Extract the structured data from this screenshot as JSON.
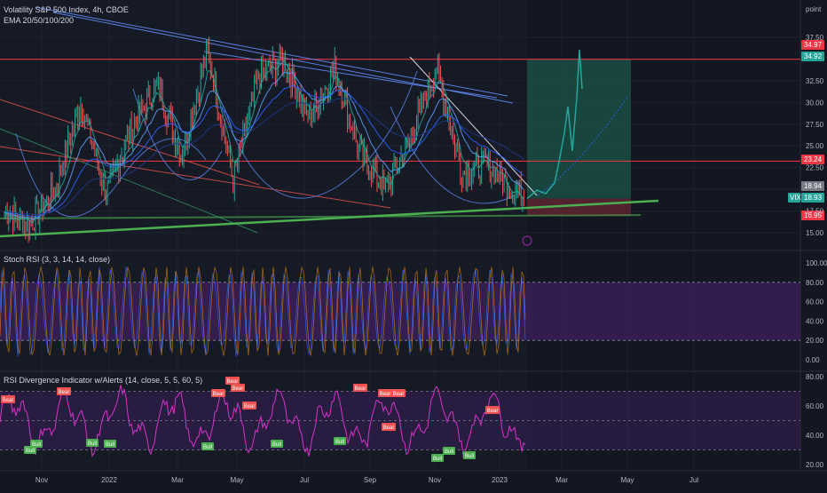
{
  "header": {
    "symbol_title": "Volatility S&P 500 Index, 4h, CBOE",
    "ema_label": "EMA 20/50/100/200",
    "stoch_label": "Stoch RSI (3, 3, 14, 14, close)",
    "rsidiv_label": "RSI Divergence Indicator w/Alerts (14, close, 5, 5, 60, 5)",
    "price_axis_title": "point"
  },
  "colors": {
    "background": "#131722",
    "price_up": "#26a69a",
    "price_down": "#ef5350",
    "resistance": "#f23645",
    "support": "#4caf50",
    "downtrend": "#5b7fe0",
    "target_box": "#1b4d44",
    "stop_box": "#5a2331",
    "stoch_band": "#3b1f5a",
    "rsi_line": "#d633c8",
    "bear_label": "#ef5350",
    "bull_label": "#4caf50"
  },
  "price_axis": {
    "ticks": [
      "37.50",
      "32.50",
      "30.00",
      "27.50",
      "25.00",
      "22.50",
      "17.50",
      "15.00"
    ]
  },
  "price_tags": [
    {
      "text": "34.97",
      "color": "#f23645"
    },
    {
      "text": "34.92",
      "color": "#26a69a"
    },
    {
      "text": "23.24",
      "color": "#f23645"
    },
    {
      "text": "18.94",
      "color": "#787b86"
    },
    {
      "text": "18.93",
      "color": "#26a69a"
    },
    {
      "text": "16.95",
      "color": "#f23645"
    }
  ],
  "vix_badge": "VIX",
  "stoch_axis": {
    "ticks": [
      "100.00",
      "80.00",
      "60.00",
      "40.00",
      "20.00",
      "0.00"
    ]
  },
  "rsi_axis": {
    "ticks": [
      "80.00",
      "60.00",
      "40.00",
      "20.00"
    ]
  },
  "time_axis": {
    "ticks": [
      "Nov",
      "2022",
      "Mar",
      "May",
      "Jul",
      "Sep",
      "Nov",
      "2023",
      "Mar",
      "May",
      "Jul"
    ]
  },
  "divergence_labels": {
    "bear": "Bear",
    "bull": "Bull"
  },
  "chart_data": {
    "type": "line",
    "title": "Volatility S&P 500 Index, 4h, CBOE",
    "timeframe": "4h",
    "x_range": [
      "2021-10",
      "2023-08"
    ],
    "ylim": [
      14,
      38.5
    ],
    "resistance_levels": [
      34.97,
      23.24
    ],
    "support_level": 16.95,
    "last_price": 18.93,
    "close_approx": [
      [
        "2021-10",
        17.5
      ],
      [
        "2021-11",
        16
      ],
      [
        "2021-11",
        20
      ],
      [
        "2021-12",
        30
      ],
      [
        "2021-12",
        19.5
      ],
      [
        "2022-01",
        27
      ],
      [
        "2022-01",
        32
      ],
      [
        "2022-02",
        24
      ],
      [
        "2022-03",
        36
      ],
      [
        "2022-03",
        21
      ],
      [
        "2022-04",
        33
      ],
      [
        "2022-05",
        35
      ],
      [
        "2022-06",
        28
      ],
      [
        "2022-06",
        34
      ],
      [
        "2022-07",
        24
      ],
      [
        "2022-08",
        20
      ],
      [
        "2022-09",
        26
      ],
      [
        "2022-10",
        34
      ],
      [
        "2022-11",
        22
      ],
      [
        "2022-12",
        23
      ],
      [
        "2022-12",
        20
      ],
      [
        "2023-01",
        18.9
      ],
      [
        "2023-03",
        30
      ],
      [
        "2023-03",
        35
      ]
    ],
    "stoch_rsi": {
      "ylim": [
        0,
        100
      ],
      "bands": [
        20,
        80
      ]
    },
    "rsi_divergence": {
      "ylim": [
        20,
        80
      ]
    },
    "grid": true
  }
}
